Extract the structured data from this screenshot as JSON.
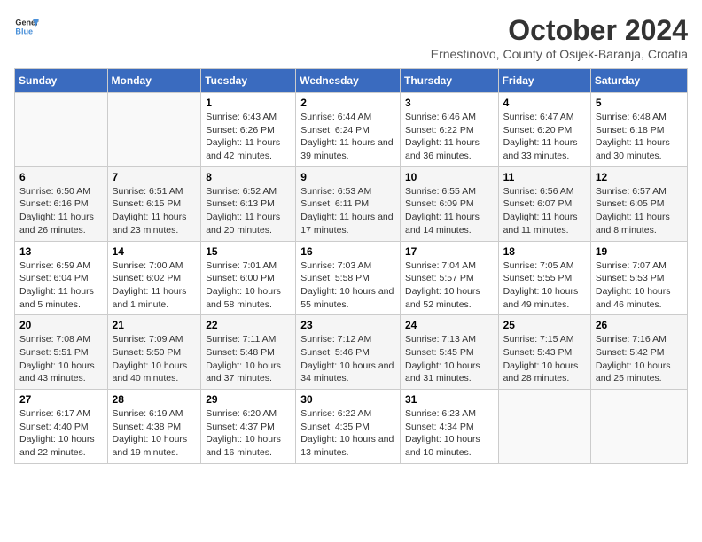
{
  "header": {
    "logo_general": "General",
    "logo_blue": "Blue",
    "month_title": "October 2024",
    "location": "Ernestinovo, County of Osijek-Baranja, Croatia"
  },
  "days_of_week": [
    "Sunday",
    "Monday",
    "Tuesday",
    "Wednesday",
    "Thursday",
    "Friday",
    "Saturday"
  ],
  "weeks": [
    [
      {
        "day": "",
        "sunrise": "",
        "sunset": "",
        "daylight": ""
      },
      {
        "day": "",
        "sunrise": "",
        "sunset": "",
        "daylight": ""
      },
      {
        "day": "1",
        "sunrise": "Sunrise: 6:43 AM",
        "sunset": "Sunset: 6:26 PM",
        "daylight": "Daylight: 11 hours and 42 minutes."
      },
      {
        "day": "2",
        "sunrise": "Sunrise: 6:44 AM",
        "sunset": "Sunset: 6:24 PM",
        "daylight": "Daylight: 11 hours and 39 minutes."
      },
      {
        "day": "3",
        "sunrise": "Sunrise: 6:46 AM",
        "sunset": "Sunset: 6:22 PM",
        "daylight": "Daylight: 11 hours and 36 minutes."
      },
      {
        "day": "4",
        "sunrise": "Sunrise: 6:47 AM",
        "sunset": "Sunset: 6:20 PM",
        "daylight": "Daylight: 11 hours and 33 minutes."
      },
      {
        "day": "5",
        "sunrise": "Sunrise: 6:48 AM",
        "sunset": "Sunset: 6:18 PM",
        "daylight": "Daylight: 11 hours and 30 minutes."
      }
    ],
    [
      {
        "day": "6",
        "sunrise": "Sunrise: 6:50 AM",
        "sunset": "Sunset: 6:16 PM",
        "daylight": "Daylight: 11 hours and 26 minutes."
      },
      {
        "day": "7",
        "sunrise": "Sunrise: 6:51 AM",
        "sunset": "Sunset: 6:15 PM",
        "daylight": "Daylight: 11 hours and 23 minutes."
      },
      {
        "day": "8",
        "sunrise": "Sunrise: 6:52 AM",
        "sunset": "Sunset: 6:13 PM",
        "daylight": "Daylight: 11 hours and 20 minutes."
      },
      {
        "day": "9",
        "sunrise": "Sunrise: 6:53 AM",
        "sunset": "Sunset: 6:11 PM",
        "daylight": "Daylight: 11 hours and 17 minutes."
      },
      {
        "day": "10",
        "sunrise": "Sunrise: 6:55 AM",
        "sunset": "Sunset: 6:09 PM",
        "daylight": "Daylight: 11 hours and 14 minutes."
      },
      {
        "day": "11",
        "sunrise": "Sunrise: 6:56 AM",
        "sunset": "Sunset: 6:07 PM",
        "daylight": "Daylight: 11 hours and 11 minutes."
      },
      {
        "day": "12",
        "sunrise": "Sunrise: 6:57 AM",
        "sunset": "Sunset: 6:05 PM",
        "daylight": "Daylight: 11 hours and 8 minutes."
      }
    ],
    [
      {
        "day": "13",
        "sunrise": "Sunrise: 6:59 AM",
        "sunset": "Sunset: 6:04 PM",
        "daylight": "Daylight: 11 hours and 5 minutes."
      },
      {
        "day": "14",
        "sunrise": "Sunrise: 7:00 AM",
        "sunset": "Sunset: 6:02 PM",
        "daylight": "Daylight: 11 hours and 1 minute."
      },
      {
        "day": "15",
        "sunrise": "Sunrise: 7:01 AM",
        "sunset": "Sunset: 6:00 PM",
        "daylight": "Daylight: 10 hours and 58 minutes."
      },
      {
        "day": "16",
        "sunrise": "Sunrise: 7:03 AM",
        "sunset": "Sunset: 5:58 PM",
        "daylight": "Daylight: 10 hours and 55 minutes."
      },
      {
        "day": "17",
        "sunrise": "Sunrise: 7:04 AM",
        "sunset": "Sunset: 5:57 PM",
        "daylight": "Daylight: 10 hours and 52 minutes."
      },
      {
        "day": "18",
        "sunrise": "Sunrise: 7:05 AM",
        "sunset": "Sunset: 5:55 PM",
        "daylight": "Daylight: 10 hours and 49 minutes."
      },
      {
        "day": "19",
        "sunrise": "Sunrise: 7:07 AM",
        "sunset": "Sunset: 5:53 PM",
        "daylight": "Daylight: 10 hours and 46 minutes."
      }
    ],
    [
      {
        "day": "20",
        "sunrise": "Sunrise: 7:08 AM",
        "sunset": "Sunset: 5:51 PM",
        "daylight": "Daylight: 10 hours and 43 minutes."
      },
      {
        "day": "21",
        "sunrise": "Sunrise: 7:09 AM",
        "sunset": "Sunset: 5:50 PM",
        "daylight": "Daylight: 10 hours and 40 minutes."
      },
      {
        "day": "22",
        "sunrise": "Sunrise: 7:11 AM",
        "sunset": "Sunset: 5:48 PM",
        "daylight": "Daylight: 10 hours and 37 minutes."
      },
      {
        "day": "23",
        "sunrise": "Sunrise: 7:12 AM",
        "sunset": "Sunset: 5:46 PM",
        "daylight": "Daylight: 10 hours and 34 minutes."
      },
      {
        "day": "24",
        "sunrise": "Sunrise: 7:13 AM",
        "sunset": "Sunset: 5:45 PM",
        "daylight": "Daylight: 10 hours and 31 minutes."
      },
      {
        "day": "25",
        "sunrise": "Sunrise: 7:15 AM",
        "sunset": "Sunset: 5:43 PM",
        "daylight": "Daylight: 10 hours and 28 minutes."
      },
      {
        "day": "26",
        "sunrise": "Sunrise: 7:16 AM",
        "sunset": "Sunset: 5:42 PM",
        "daylight": "Daylight: 10 hours and 25 minutes."
      }
    ],
    [
      {
        "day": "27",
        "sunrise": "Sunrise: 6:17 AM",
        "sunset": "Sunset: 4:40 PM",
        "daylight": "Daylight: 10 hours and 22 minutes."
      },
      {
        "day": "28",
        "sunrise": "Sunrise: 6:19 AM",
        "sunset": "Sunset: 4:38 PM",
        "daylight": "Daylight: 10 hours and 19 minutes."
      },
      {
        "day": "29",
        "sunrise": "Sunrise: 6:20 AM",
        "sunset": "Sunset: 4:37 PM",
        "daylight": "Daylight: 10 hours and 16 minutes."
      },
      {
        "day": "30",
        "sunrise": "Sunrise: 6:22 AM",
        "sunset": "Sunset: 4:35 PM",
        "daylight": "Daylight: 10 hours and 13 minutes."
      },
      {
        "day": "31",
        "sunrise": "Sunrise: 6:23 AM",
        "sunset": "Sunset: 4:34 PM",
        "daylight": "Daylight: 10 hours and 10 minutes."
      },
      {
        "day": "",
        "sunrise": "",
        "sunset": "",
        "daylight": ""
      },
      {
        "day": "",
        "sunrise": "",
        "sunset": "",
        "daylight": ""
      }
    ]
  ]
}
